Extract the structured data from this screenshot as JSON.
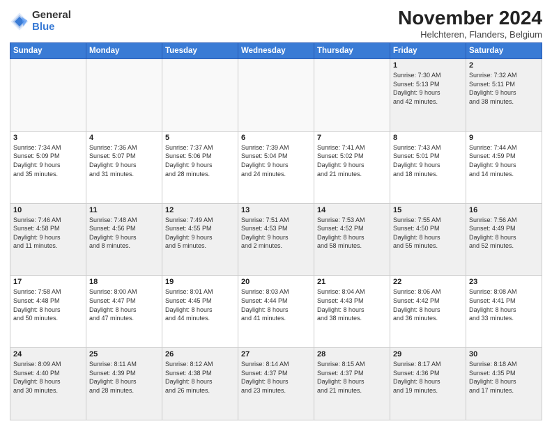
{
  "header": {
    "logo_general": "General",
    "logo_blue": "Blue",
    "month_title": "November 2024",
    "location": "Helchteren, Flanders, Belgium"
  },
  "weekdays": [
    "Sunday",
    "Monday",
    "Tuesday",
    "Wednesday",
    "Thursday",
    "Friday",
    "Saturday"
  ],
  "weeks": [
    [
      {
        "day": "",
        "info": ""
      },
      {
        "day": "",
        "info": ""
      },
      {
        "day": "",
        "info": ""
      },
      {
        "day": "",
        "info": ""
      },
      {
        "day": "",
        "info": ""
      },
      {
        "day": "1",
        "info": "Sunrise: 7:30 AM\nSunset: 5:13 PM\nDaylight: 9 hours\nand 42 minutes."
      },
      {
        "day": "2",
        "info": "Sunrise: 7:32 AM\nSunset: 5:11 PM\nDaylight: 9 hours\nand 38 minutes."
      }
    ],
    [
      {
        "day": "3",
        "info": "Sunrise: 7:34 AM\nSunset: 5:09 PM\nDaylight: 9 hours\nand 35 minutes."
      },
      {
        "day": "4",
        "info": "Sunrise: 7:36 AM\nSunset: 5:07 PM\nDaylight: 9 hours\nand 31 minutes."
      },
      {
        "day": "5",
        "info": "Sunrise: 7:37 AM\nSunset: 5:06 PM\nDaylight: 9 hours\nand 28 minutes."
      },
      {
        "day": "6",
        "info": "Sunrise: 7:39 AM\nSunset: 5:04 PM\nDaylight: 9 hours\nand 24 minutes."
      },
      {
        "day": "7",
        "info": "Sunrise: 7:41 AM\nSunset: 5:02 PM\nDaylight: 9 hours\nand 21 minutes."
      },
      {
        "day": "8",
        "info": "Sunrise: 7:43 AM\nSunset: 5:01 PM\nDaylight: 9 hours\nand 18 minutes."
      },
      {
        "day": "9",
        "info": "Sunrise: 7:44 AM\nSunset: 4:59 PM\nDaylight: 9 hours\nand 14 minutes."
      }
    ],
    [
      {
        "day": "10",
        "info": "Sunrise: 7:46 AM\nSunset: 4:58 PM\nDaylight: 9 hours\nand 11 minutes."
      },
      {
        "day": "11",
        "info": "Sunrise: 7:48 AM\nSunset: 4:56 PM\nDaylight: 9 hours\nand 8 minutes."
      },
      {
        "day": "12",
        "info": "Sunrise: 7:49 AM\nSunset: 4:55 PM\nDaylight: 9 hours\nand 5 minutes."
      },
      {
        "day": "13",
        "info": "Sunrise: 7:51 AM\nSunset: 4:53 PM\nDaylight: 9 hours\nand 2 minutes."
      },
      {
        "day": "14",
        "info": "Sunrise: 7:53 AM\nSunset: 4:52 PM\nDaylight: 8 hours\nand 58 minutes."
      },
      {
        "day": "15",
        "info": "Sunrise: 7:55 AM\nSunset: 4:50 PM\nDaylight: 8 hours\nand 55 minutes."
      },
      {
        "day": "16",
        "info": "Sunrise: 7:56 AM\nSunset: 4:49 PM\nDaylight: 8 hours\nand 52 minutes."
      }
    ],
    [
      {
        "day": "17",
        "info": "Sunrise: 7:58 AM\nSunset: 4:48 PM\nDaylight: 8 hours\nand 50 minutes."
      },
      {
        "day": "18",
        "info": "Sunrise: 8:00 AM\nSunset: 4:47 PM\nDaylight: 8 hours\nand 47 minutes."
      },
      {
        "day": "19",
        "info": "Sunrise: 8:01 AM\nSunset: 4:45 PM\nDaylight: 8 hours\nand 44 minutes."
      },
      {
        "day": "20",
        "info": "Sunrise: 8:03 AM\nSunset: 4:44 PM\nDaylight: 8 hours\nand 41 minutes."
      },
      {
        "day": "21",
        "info": "Sunrise: 8:04 AM\nSunset: 4:43 PM\nDaylight: 8 hours\nand 38 minutes."
      },
      {
        "day": "22",
        "info": "Sunrise: 8:06 AM\nSunset: 4:42 PM\nDaylight: 8 hours\nand 36 minutes."
      },
      {
        "day": "23",
        "info": "Sunrise: 8:08 AM\nSunset: 4:41 PM\nDaylight: 8 hours\nand 33 minutes."
      }
    ],
    [
      {
        "day": "24",
        "info": "Sunrise: 8:09 AM\nSunset: 4:40 PM\nDaylight: 8 hours\nand 30 minutes."
      },
      {
        "day": "25",
        "info": "Sunrise: 8:11 AM\nSunset: 4:39 PM\nDaylight: 8 hours\nand 28 minutes."
      },
      {
        "day": "26",
        "info": "Sunrise: 8:12 AM\nSunset: 4:38 PM\nDaylight: 8 hours\nand 26 minutes."
      },
      {
        "day": "27",
        "info": "Sunrise: 8:14 AM\nSunset: 4:37 PM\nDaylight: 8 hours\nand 23 minutes."
      },
      {
        "day": "28",
        "info": "Sunrise: 8:15 AM\nSunset: 4:37 PM\nDaylight: 8 hours\nand 21 minutes."
      },
      {
        "day": "29",
        "info": "Sunrise: 8:17 AM\nSunset: 4:36 PM\nDaylight: 8 hours\nand 19 minutes."
      },
      {
        "day": "30",
        "info": "Sunrise: 8:18 AM\nSunset: 4:35 PM\nDaylight: 8 hours\nand 17 minutes."
      }
    ]
  ]
}
